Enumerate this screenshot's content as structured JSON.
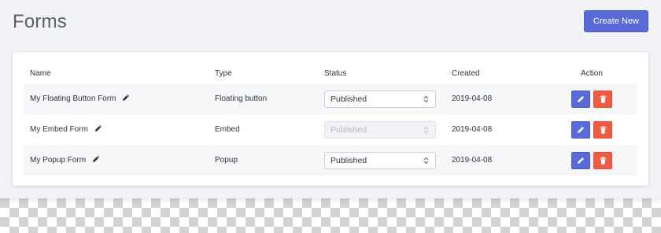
{
  "header": {
    "title": "Forms",
    "create_label": "Create New"
  },
  "table": {
    "columns": [
      "Name",
      "Type",
      "Status",
      "Created",
      "Action"
    ],
    "rows": [
      {
        "name": "My Floating Button Form",
        "type": "Floating button",
        "status": "Published",
        "status_disabled": false,
        "created": "2019-04-08"
      },
      {
        "name": "My Embed Form",
        "type": "Embed",
        "status": "Published",
        "status_disabled": true,
        "created": "2019-04-08"
      },
      {
        "name": "My Popup Form",
        "type": "Popup",
        "status": "Published",
        "status_disabled": false,
        "created": "2019-04-08"
      }
    ]
  },
  "icons": {
    "name_edit": "pencil-icon",
    "edit": "pencil-icon",
    "delete": "trash-icon",
    "select_caret": "chevron-up-down-icon"
  },
  "colors": {
    "primary": "#5a6ad6",
    "danger": "#ef5c44",
    "page_bg": "#f1f3f7"
  }
}
